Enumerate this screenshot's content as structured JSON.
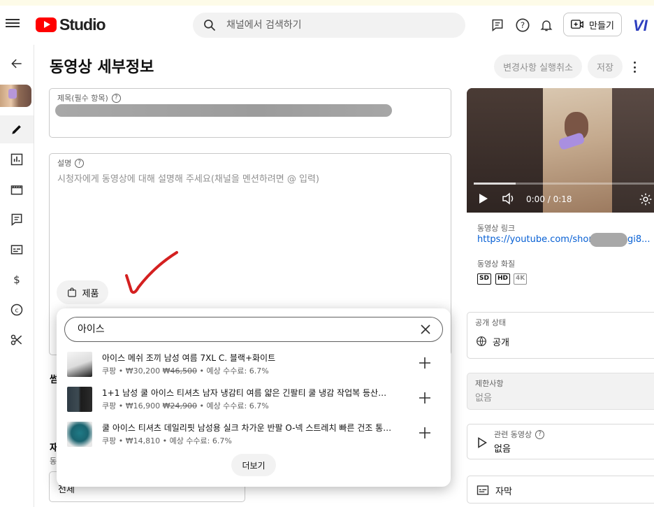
{
  "header": {
    "logo_text": "Studio",
    "search_placeholder": "채널에서 검색하기",
    "create_label": "만들기",
    "avatar_text": "VI"
  },
  "page": {
    "title": "동영상 세부정보",
    "undo_label": "변경사항 실행취소",
    "save_label": "저장"
  },
  "form": {
    "title_label": "제목(필수 항목)",
    "description_label": "설명",
    "description_placeholder": "시청자에게 동영상에 대해 설명해 주세요(채널을 멘션하려면 @ 입력)",
    "product_chip_label": "제품",
    "hidden_fragments": [
      "썸",
      "재",
      "동"
    ],
    "select_fragment": "전체"
  },
  "product_popup": {
    "search_value": "아이스",
    "more_label": "더보기",
    "products": [
      {
        "title": "아이스 메쉬 조끼 남성 여름 7XL C. 블랙+화이트",
        "meta_prefix": "쿠팡 • ₩30,200 ",
        "orig_price": "₩46,500",
        "meta_suffix": " • 예상 수수료: 6.7%"
      },
      {
        "title": "1+1 남성 쿨 아이스 티셔츠 남자 냉감티 여름 얇은 긴팔티 쿨 냉감 작업복 등산복 상의...",
        "meta_prefix": "쿠팡 • ₩16,900 ",
        "orig_price": "₩24,900",
        "meta_suffix": " • 예상 수수료: 6.7%"
      },
      {
        "title": "쿨 아이스 티셔츠 데일리핏 남성용 실크 차가운 반팔 O-넥 스트레치 빠른 건조 통기성 ...",
        "meta_prefix": "쿠팡 • ₩14,810 ",
        "orig_price": "",
        "meta_suffix": "• 예상 수수료: 6.7%"
      }
    ]
  },
  "video": {
    "time": "0:00 / 0:18",
    "link_label": "동영상 링크",
    "link_text": "https://youtube.com/shorts",
    "link_tail": "gi8...",
    "quality_label": "동영상 화질",
    "quality_badges": [
      "SD",
      "HD",
      "4K"
    ]
  },
  "sidebar_right": {
    "visibility_label": "공개 상태",
    "visibility_value": "공개",
    "restrictions_label": "제한사항",
    "restrictions_value": "없음",
    "related_label": "관련 동영상",
    "related_value": "없음",
    "subtitles_label": "자막"
  },
  "colors": {
    "brand_red": "#ff0000",
    "link_blue": "#065fd4",
    "annotation_red": "#d42020"
  }
}
